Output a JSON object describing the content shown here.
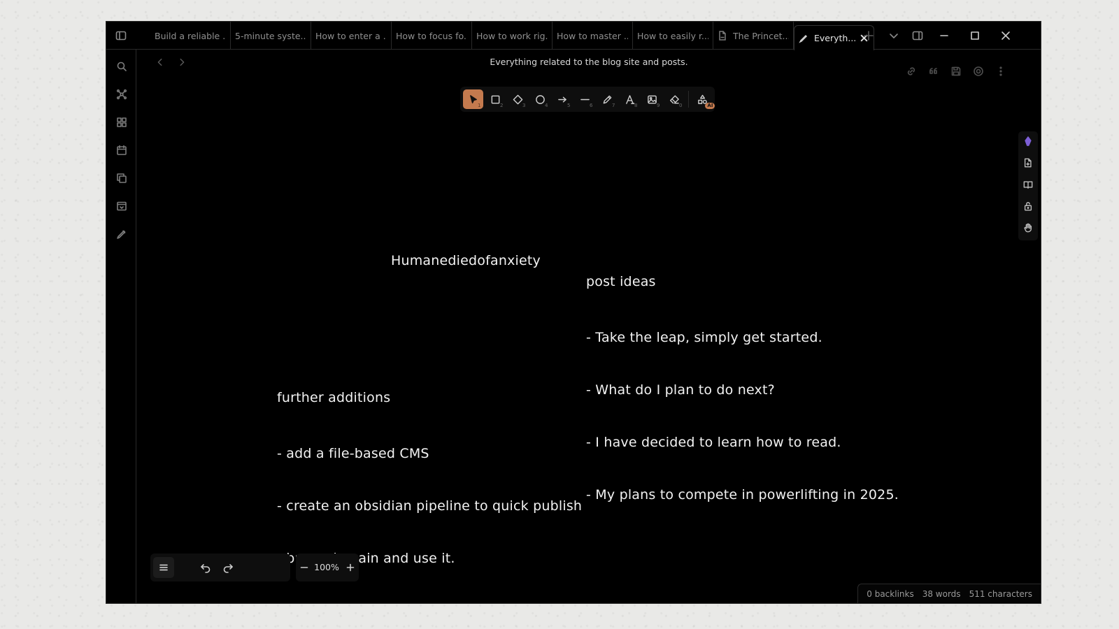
{
  "tabs": [
    {
      "label": "Build a reliable ...",
      "icon": null
    },
    {
      "label": "5-minute syste...",
      "icon": null
    },
    {
      "label": "How to enter a ...",
      "icon": null
    },
    {
      "label": "How to focus fo...",
      "icon": null
    },
    {
      "label": "How to work rig...",
      "icon": null
    },
    {
      "label": "How to master ...",
      "icon": null
    },
    {
      "label": "How to easily r...",
      "icon": null
    },
    {
      "label": "The Princet...",
      "icon": "pdf-icon"
    },
    {
      "label": "Everyth...",
      "icon": "excalidraw-icon",
      "active": true
    }
  ],
  "note_title": "Everything related to the blog site and posts.",
  "toolbar": {
    "tools": [
      {
        "name": "selection-tool",
        "key": "1"
      },
      {
        "name": "rectangle-tool",
        "key": "2"
      },
      {
        "name": "diamond-tool",
        "key": "3"
      },
      {
        "name": "ellipse-tool",
        "key": "4"
      },
      {
        "name": "arrow-tool",
        "key": "5"
      },
      {
        "name": "line-tool",
        "key": "6"
      },
      {
        "name": "draw-tool",
        "key": "7"
      },
      {
        "name": "text-tool",
        "key": "8"
      },
      {
        "name": "image-tool",
        "key": "9"
      },
      {
        "name": "eraser-tool",
        "key": "0"
      }
    ],
    "ai_badge": "AI"
  },
  "canvas": {
    "center_label": "Humanediedofanxiety",
    "post_ideas": {
      "title": "post ideas",
      "items": [
        "- Take the leap, simply get started.",
        "- What do I plan to do next?",
        "- I have decided to learn how to read.",
        "- My plans to compete in powerlifting in 2025."
      ]
    },
    "further_additions": {
      "title": "further additions",
      "items": [
        "- add a file-based CMS",
        "- create an obsidian pipeline to quick publish",
        "- buy a domain and use it."
      ]
    }
  },
  "zoom": {
    "level": "100%"
  },
  "status": {
    "backlinks": "0 backlinks",
    "words": "38 words",
    "characters": "511 characters"
  },
  "colors": {
    "accent": "#c47a4e",
    "background": "#000000",
    "canvas_text": "#f2f2f2"
  }
}
